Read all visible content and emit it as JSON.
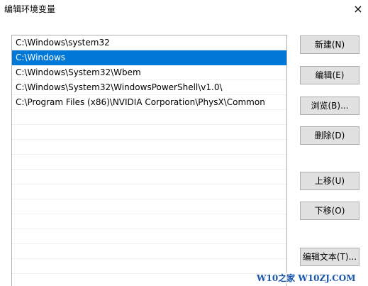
{
  "window": {
    "title": "编辑环境变量",
    "close_glyph": "×"
  },
  "list": {
    "items": [
      "C:\\Windows\\system32",
      "C:\\Windows",
      "C:\\Windows\\System32\\Wbem",
      "C:\\Windows\\System32\\WindowsPowerShell\\v1.0\\",
      "C:\\Program Files (x86)\\NVIDIA Corporation\\PhysX\\Common"
    ],
    "selected_index": 1,
    "empty_rows": 11
  },
  "buttons": {
    "new": "新建(N)",
    "edit": "编辑(E)",
    "browse": "浏览(B)...",
    "delete": "删除(D)",
    "move_up": "上移(U)",
    "move_down": "下移(O)",
    "edit_text": "编辑文本(T)..."
  },
  "watermark": "W10之家 W10ZJ.COM",
  "colors": {
    "selection": "#0078d7",
    "button_bg": "#e1e1e1",
    "watermark": "#1a55b0"
  }
}
